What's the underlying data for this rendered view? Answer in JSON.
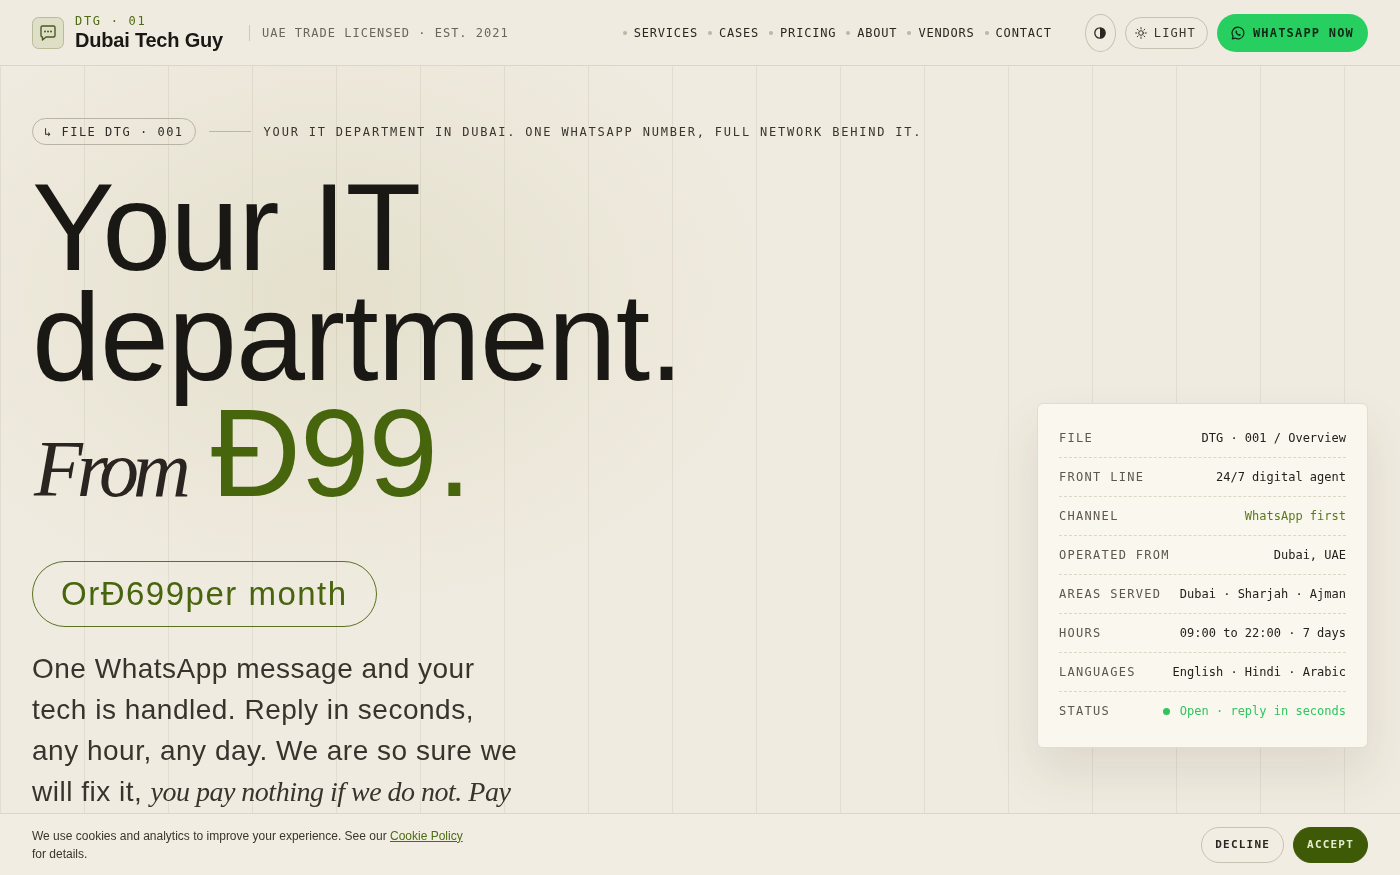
{
  "header": {
    "brand_code": "DTG · 01",
    "brand_name": "Dubai Tech Guy",
    "license": "UAE TRADE LICENSED · EST. 2021",
    "nav": [
      "SERVICES",
      "CASES",
      "PRICING",
      "ABOUT",
      "VENDORS",
      "CONTACT"
    ],
    "theme_button": "LIGHT",
    "cta_button": "WHATSAPP NOW"
  },
  "hero": {
    "file_tag": "↳ FILE DTG · 001",
    "tagline": "YOUR IT DEPARTMENT IN DUBAI. ONE WHATSAPP NUMBER, FULL NETWORK BEHIND IT.",
    "headline": "Your IT department.",
    "price_lead": "From",
    "price": "Đ99.",
    "monthly_price": "OrĐ699per month",
    "description": "One WhatsApp message and your tech is handled. Reply in seconds, any hour, any day. We are so sure we will fix it, *you pay nothing if we do not. Pay*"
  },
  "info_card": {
    "rows": [
      {
        "label": "FILE",
        "value": "DTG · 001 / Overview",
        "kind": "plain"
      },
      {
        "label": "FRONT LINE",
        "value": "24/7 digital agent",
        "kind": "plain"
      },
      {
        "label": "CHANNEL",
        "value": "WhatsApp first",
        "kind": "accent"
      },
      {
        "label": "OPERATED FROM",
        "value": "Dubai, UAE",
        "kind": "plain"
      },
      {
        "label": "AREAS SERVED",
        "value": "Dubai · Sharjah · Ajman",
        "kind": "plain"
      },
      {
        "label": "HOURS",
        "value": "09:00 to 22:00 · 7 days",
        "kind": "plain"
      },
      {
        "label": "LANGUAGES",
        "value": "English · Hindi · Arabic",
        "kind": "plain"
      },
      {
        "label": "STATUS",
        "value": "Open · reply in seconds",
        "kind": "status"
      }
    ]
  },
  "cookie_banner": {
    "text": "We use cookies and analytics to improve your experience. See our",
    "link": "Cookie Policy",
    "text_after": "for details.",
    "buttons": [
      {
        "label": "DECLINE",
        "kind": "secondary"
      },
      {
        "label": "ACCEPT",
        "kind": "primary"
      }
    ]
  }
}
